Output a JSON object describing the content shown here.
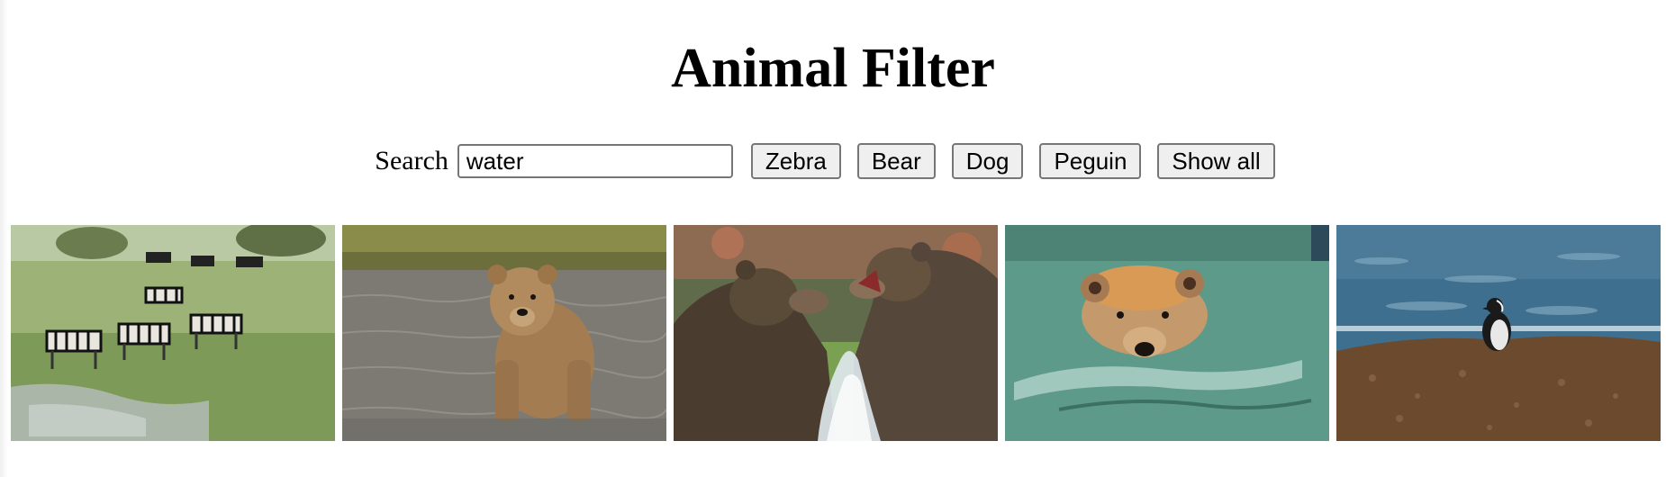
{
  "header": {
    "title": "Animal Filter"
  },
  "search": {
    "label": "Search",
    "value": "water",
    "placeholder": ""
  },
  "filters": {
    "buttons": [
      "Zebra",
      "Bear",
      "Dog",
      "Peguin",
      "Show all"
    ]
  },
  "gallery": {
    "images": [
      {
        "subject": "zebras-and-wildebeest-at-watering-hole"
      },
      {
        "subject": "brown-bear-standing-in-water"
      },
      {
        "subject": "two-bears-fighting-in-water"
      },
      {
        "subject": "bear-swimming"
      },
      {
        "subject": "penguin-on-beach-by-sea"
      }
    ]
  }
}
